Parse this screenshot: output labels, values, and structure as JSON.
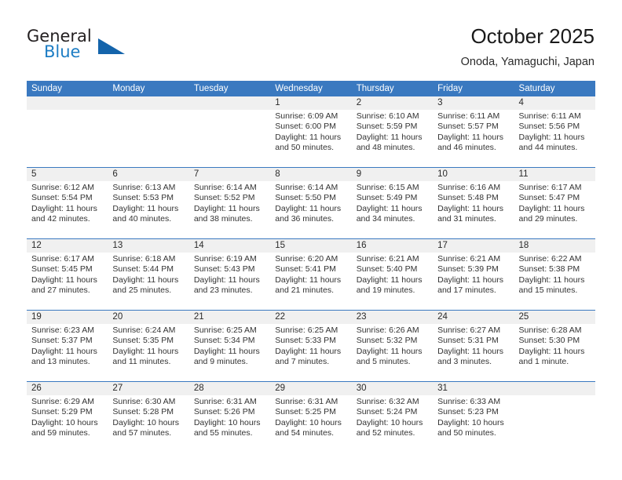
{
  "brand": {
    "name_part1": "General",
    "name_part2": "Blue",
    "triangle_color": "#1464ab",
    "blue": "#1d7dc4"
  },
  "header": {
    "title": "October 2025",
    "subtitle": "Onoda, Yamaguchi, Japan"
  },
  "theme": {
    "header_blue": "#3a79c0",
    "band_gray": "#f0f0f0",
    "text": "#333333"
  },
  "weekdays": [
    "Sunday",
    "Monday",
    "Tuesday",
    "Wednesday",
    "Thursday",
    "Friday",
    "Saturday"
  ],
  "weeks": [
    [
      {
        "day": "",
        "sunrise": "",
        "sunset": "",
        "daylight1": "",
        "daylight2": ""
      },
      {
        "day": "",
        "sunrise": "",
        "sunset": "",
        "daylight1": "",
        "daylight2": ""
      },
      {
        "day": "",
        "sunrise": "",
        "sunset": "",
        "daylight1": "",
        "daylight2": ""
      },
      {
        "day": "1",
        "sunrise": "Sunrise: 6:09 AM",
        "sunset": "Sunset: 6:00 PM",
        "daylight1": "Daylight: 11 hours",
        "daylight2": "and 50 minutes."
      },
      {
        "day": "2",
        "sunrise": "Sunrise: 6:10 AM",
        "sunset": "Sunset: 5:59 PM",
        "daylight1": "Daylight: 11 hours",
        "daylight2": "and 48 minutes."
      },
      {
        "day": "3",
        "sunrise": "Sunrise: 6:11 AM",
        "sunset": "Sunset: 5:57 PM",
        "daylight1": "Daylight: 11 hours",
        "daylight2": "and 46 minutes."
      },
      {
        "day": "4",
        "sunrise": "Sunrise: 6:11 AM",
        "sunset": "Sunset: 5:56 PM",
        "daylight1": "Daylight: 11 hours",
        "daylight2": "and 44 minutes."
      }
    ],
    [
      {
        "day": "5",
        "sunrise": "Sunrise: 6:12 AM",
        "sunset": "Sunset: 5:54 PM",
        "daylight1": "Daylight: 11 hours",
        "daylight2": "and 42 minutes."
      },
      {
        "day": "6",
        "sunrise": "Sunrise: 6:13 AM",
        "sunset": "Sunset: 5:53 PM",
        "daylight1": "Daylight: 11 hours",
        "daylight2": "and 40 minutes."
      },
      {
        "day": "7",
        "sunrise": "Sunrise: 6:14 AM",
        "sunset": "Sunset: 5:52 PM",
        "daylight1": "Daylight: 11 hours",
        "daylight2": "and 38 minutes."
      },
      {
        "day": "8",
        "sunrise": "Sunrise: 6:14 AM",
        "sunset": "Sunset: 5:50 PM",
        "daylight1": "Daylight: 11 hours",
        "daylight2": "and 36 minutes."
      },
      {
        "day": "9",
        "sunrise": "Sunrise: 6:15 AM",
        "sunset": "Sunset: 5:49 PM",
        "daylight1": "Daylight: 11 hours",
        "daylight2": "and 34 minutes."
      },
      {
        "day": "10",
        "sunrise": "Sunrise: 6:16 AM",
        "sunset": "Sunset: 5:48 PM",
        "daylight1": "Daylight: 11 hours",
        "daylight2": "and 31 minutes."
      },
      {
        "day": "11",
        "sunrise": "Sunrise: 6:17 AM",
        "sunset": "Sunset: 5:47 PM",
        "daylight1": "Daylight: 11 hours",
        "daylight2": "and 29 minutes."
      }
    ],
    [
      {
        "day": "12",
        "sunrise": "Sunrise: 6:17 AM",
        "sunset": "Sunset: 5:45 PM",
        "daylight1": "Daylight: 11 hours",
        "daylight2": "and 27 minutes."
      },
      {
        "day": "13",
        "sunrise": "Sunrise: 6:18 AM",
        "sunset": "Sunset: 5:44 PM",
        "daylight1": "Daylight: 11 hours",
        "daylight2": "and 25 minutes."
      },
      {
        "day": "14",
        "sunrise": "Sunrise: 6:19 AM",
        "sunset": "Sunset: 5:43 PM",
        "daylight1": "Daylight: 11 hours",
        "daylight2": "and 23 minutes."
      },
      {
        "day": "15",
        "sunrise": "Sunrise: 6:20 AM",
        "sunset": "Sunset: 5:41 PM",
        "daylight1": "Daylight: 11 hours",
        "daylight2": "and 21 minutes."
      },
      {
        "day": "16",
        "sunrise": "Sunrise: 6:21 AM",
        "sunset": "Sunset: 5:40 PM",
        "daylight1": "Daylight: 11 hours",
        "daylight2": "and 19 minutes."
      },
      {
        "day": "17",
        "sunrise": "Sunrise: 6:21 AM",
        "sunset": "Sunset: 5:39 PM",
        "daylight1": "Daylight: 11 hours",
        "daylight2": "and 17 minutes."
      },
      {
        "day": "18",
        "sunrise": "Sunrise: 6:22 AM",
        "sunset": "Sunset: 5:38 PM",
        "daylight1": "Daylight: 11 hours",
        "daylight2": "and 15 minutes."
      }
    ],
    [
      {
        "day": "19",
        "sunrise": "Sunrise: 6:23 AM",
        "sunset": "Sunset: 5:37 PM",
        "daylight1": "Daylight: 11 hours",
        "daylight2": "and 13 minutes."
      },
      {
        "day": "20",
        "sunrise": "Sunrise: 6:24 AM",
        "sunset": "Sunset: 5:35 PM",
        "daylight1": "Daylight: 11 hours",
        "daylight2": "and 11 minutes."
      },
      {
        "day": "21",
        "sunrise": "Sunrise: 6:25 AM",
        "sunset": "Sunset: 5:34 PM",
        "daylight1": "Daylight: 11 hours",
        "daylight2": "and 9 minutes."
      },
      {
        "day": "22",
        "sunrise": "Sunrise: 6:25 AM",
        "sunset": "Sunset: 5:33 PM",
        "daylight1": "Daylight: 11 hours",
        "daylight2": "and 7 minutes."
      },
      {
        "day": "23",
        "sunrise": "Sunrise: 6:26 AM",
        "sunset": "Sunset: 5:32 PM",
        "daylight1": "Daylight: 11 hours",
        "daylight2": "and 5 minutes."
      },
      {
        "day": "24",
        "sunrise": "Sunrise: 6:27 AM",
        "sunset": "Sunset: 5:31 PM",
        "daylight1": "Daylight: 11 hours",
        "daylight2": "and 3 minutes."
      },
      {
        "day": "25",
        "sunrise": "Sunrise: 6:28 AM",
        "sunset": "Sunset: 5:30 PM",
        "daylight1": "Daylight: 11 hours",
        "daylight2": "and 1 minute."
      }
    ],
    [
      {
        "day": "26",
        "sunrise": "Sunrise: 6:29 AM",
        "sunset": "Sunset: 5:29 PM",
        "daylight1": "Daylight: 10 hours",
        "daylight2": "and 59 minutes."
      },
      {
        "day": "27",
        "sunrise": "Sunrise: 6:30 AM",
        "sunset": "Sunset: 5:28 PM",
        "daylight1": "Daylight: 10 hours",
        "daylight2": "and 57 minutes."
      },
      {
        "day": "28",
        "sunrise": "Sunrise: 6:31 AM",
        "sunset": "Sunset: 5:26 PM",
        "daylight1": "Daylight: 10 hours",
        "daylight2": "and 55 minutes."
      },
      {
        "day": "29",
        "sunrise": "Sunrise: 6:31 AM",
        "sunset": "Sunset: 5:25 PM",
        "daylight1": "Daylight: 10 hours",
        "daylight2": "and 54 minutes."
      },
      {
        "day": "30",
        "sunrise": "Sunrise: 6:32 AM",
        "sunset": "Sunset: 5:24 PM",
        "daylight1": "Daylight: 10 hours",
        "daylight2": "and 52 minutes."
      },
      {
        "day": "31",
        "sunrise": "Sunrise: 6:33 AM",
        "sunset": "Sunset: 5:23 PM",
        "daylight1": "Daylight: 10 hours",
        "daylight2": "and 50 minutes."
      },
      {
        "day": "",
        "sunrise": "",
        "sunset": "",
        "daylight1": "",
        "daylight2": ""
      }
    ]
  ]
}
